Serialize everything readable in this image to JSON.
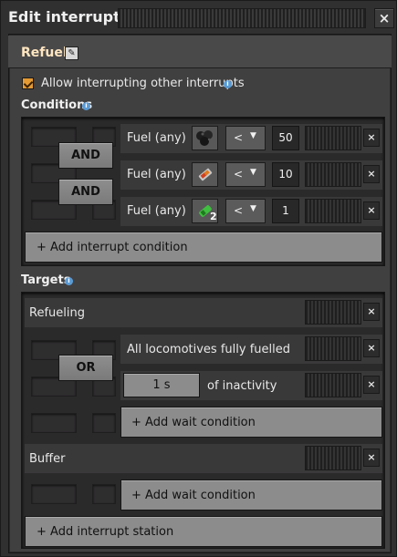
{
  "window": {
    "title": "Edit interrupt",
    "close": "×"
  },
  "interrupt": {
    "name": "Refuel"
  },
  "allow_interrupting": {
    "label": "Allow interrupting other interrupts",
    "checked": true
  },
  "conditions": {
    "header": "Conditions",
    "connectors": [
      "AND",
      "AND"
    ],
    "rows": [
      {
        "label": "Fuel (any)",
        "icon": "coal-icon",
        "operator": "<",
        "value": "50"
      },
      {
        "label": "Fuel (any)",
        "icon": "solid-fuel-icon",
        "operator": "<",
        "value": "10"
      },
      {
        "label": "Fuel (any)",
        "icon": "rocket-fuel-icon",
        "icon_badge": "2",
        "operator": "<",
        "value": "1"
      }
    ],
    "add_label": "+ Add interrupt condition"
  },
  "targets": {
    "header": "Targets",
    "stations": [
      {
        "name": "Refueling",
        "connector": "OR",
        "conditions": [
          {
            "label": "All locomotives fully fuelled"
          },
          {
            "time": "1 s",
            "suffix": "of inactivity"
          }
        ],
        "add_label": "+ Add wait condition"
      },
      {
        "name": "Buffer",
        "add_label": "+ Add wait condition"
      }
    ],
    "add_label": "+ Add interrupt station"
  },
  "remove_glyph": "×",
  "colors": {
    "checkbox": "#e59a33",
    "info": "#5a9bd5",
    "name": "#ffe6c0"
  }
}
